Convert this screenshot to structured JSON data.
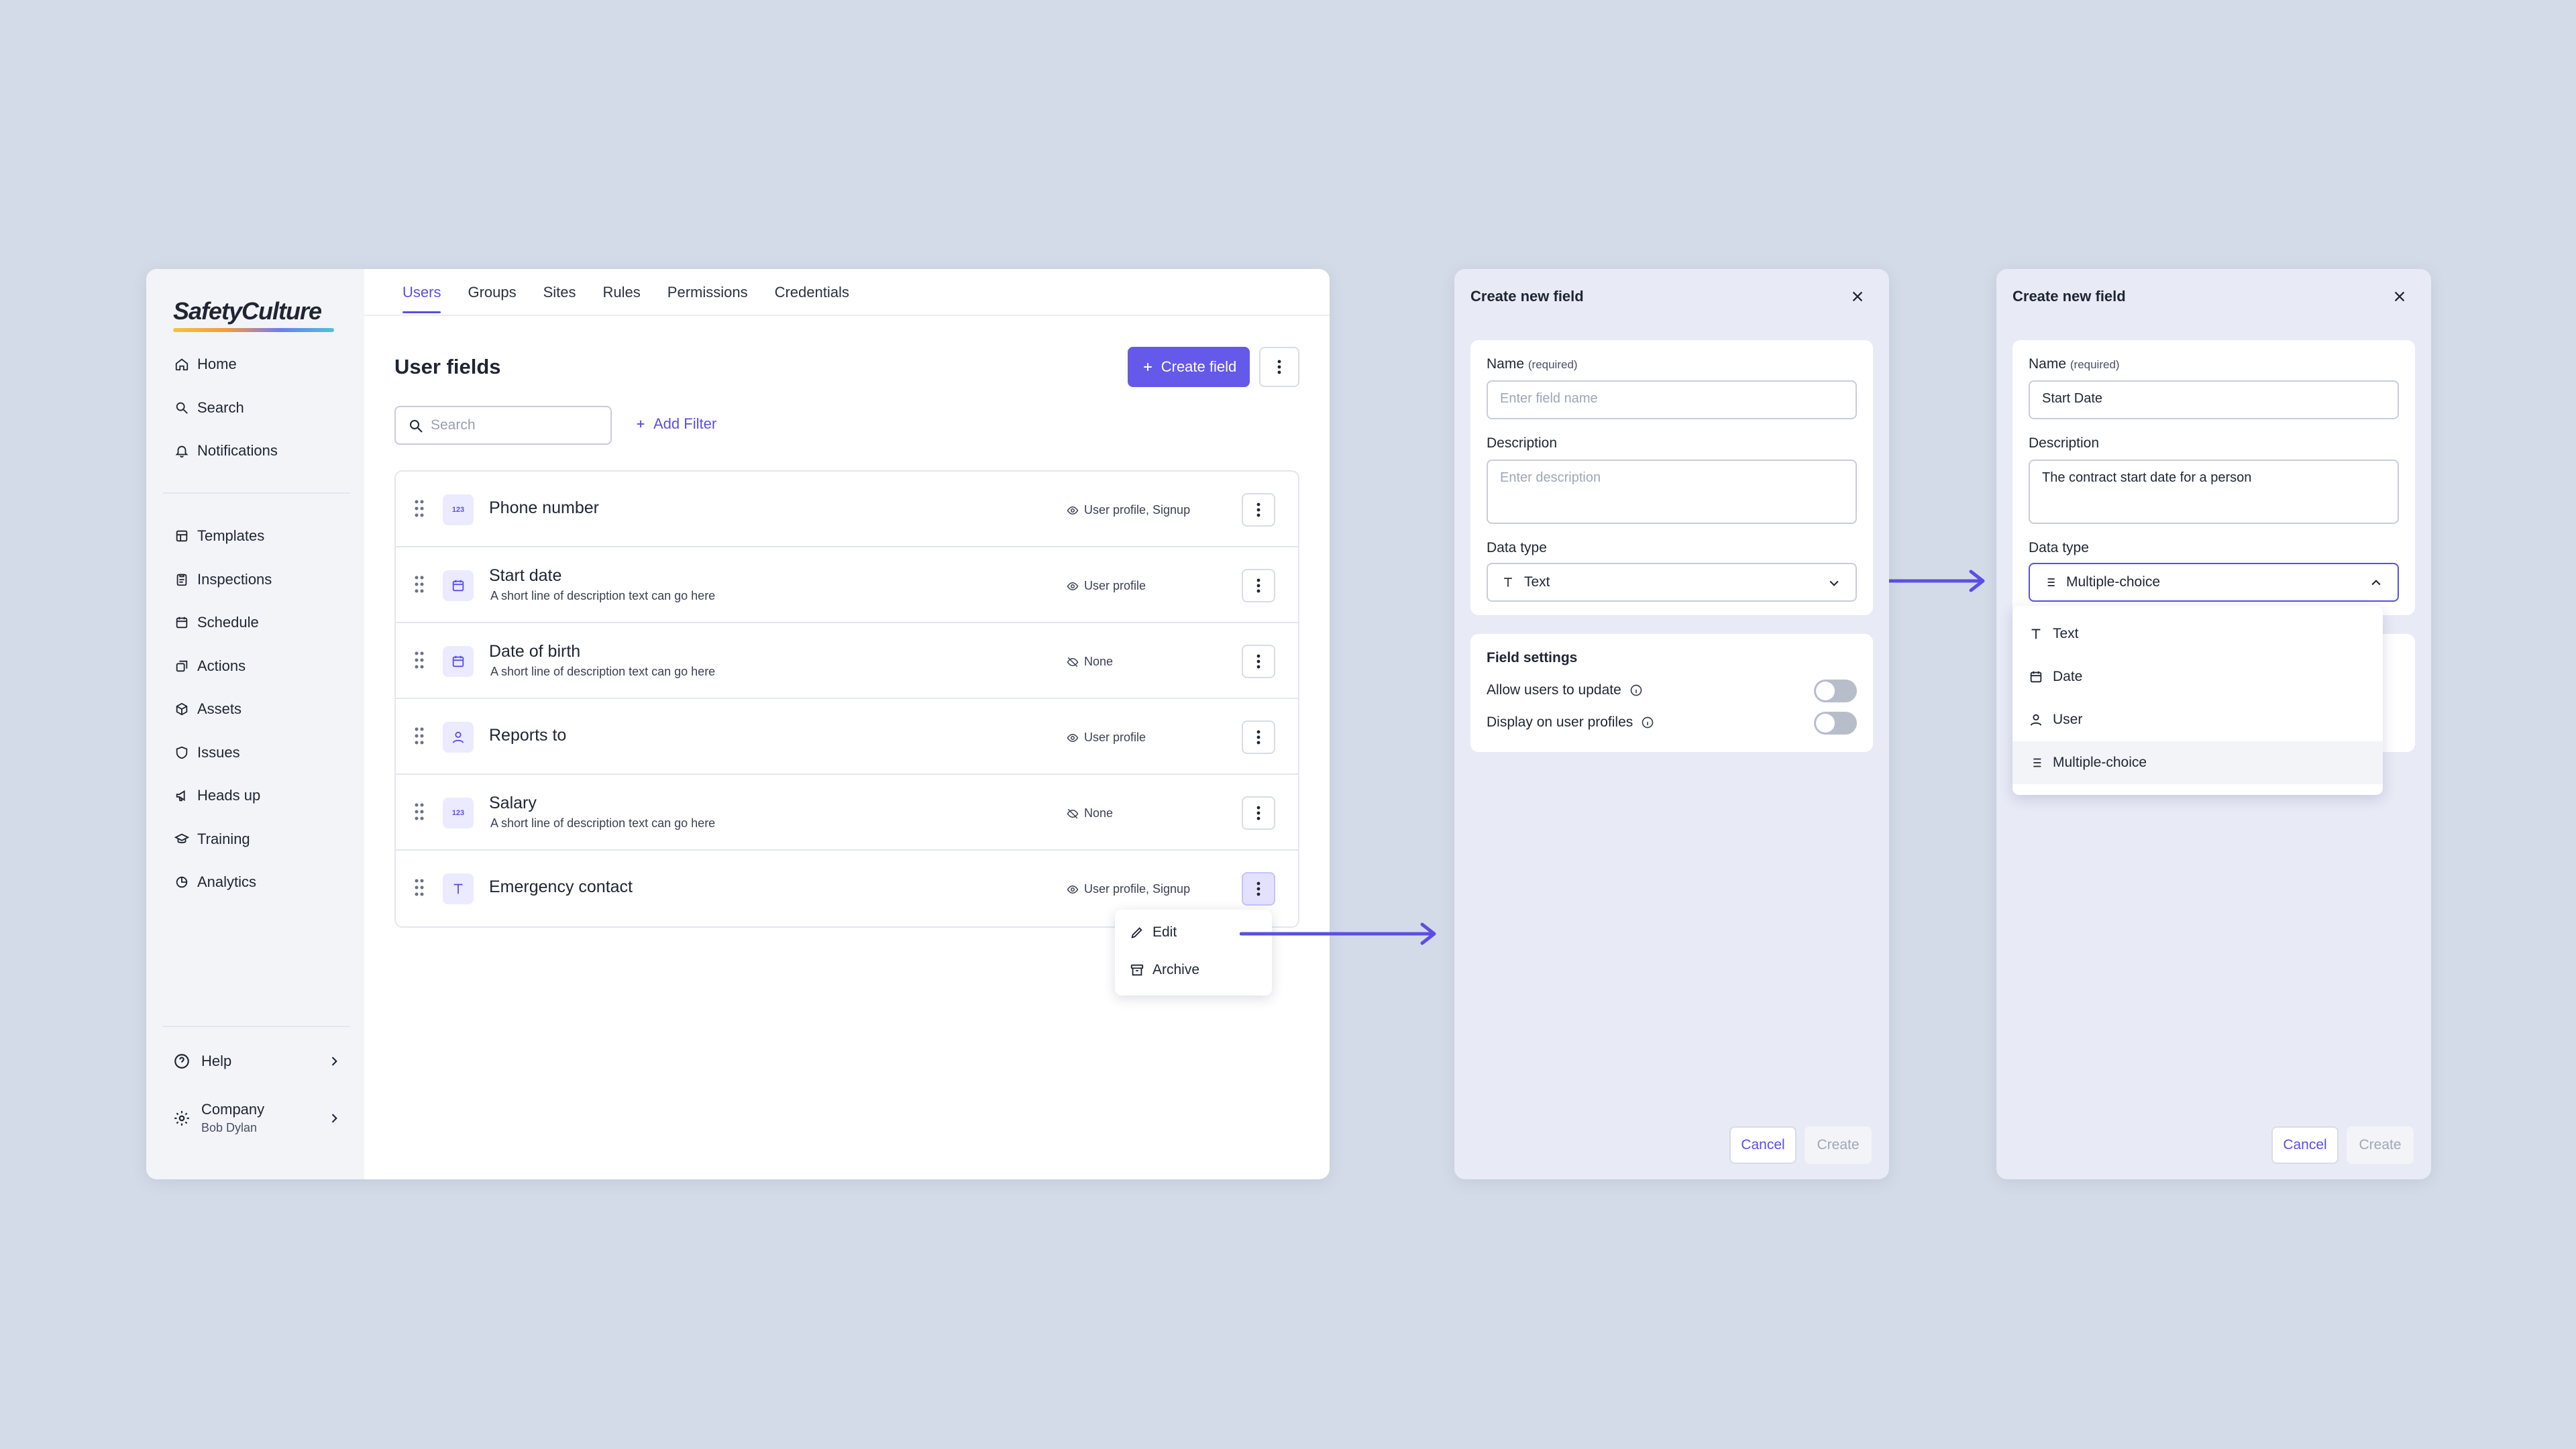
{
  "brand": "SafetyCulture",
  "nav": {
    "top": [
      {
        "label": "Home",
        "icon": "home-icon"
      },
      {
        "label": "Search",
        "icon": "search-icon"
      },
      {
        "label": "Notifications",
        "icon": "bell-icon"
      }
    ],
    "main": [
      {
        "label": "Templates",
        "icon": "templates-icon"
      },
      {
        "label": "Inspections",
        "icon": "clipboard-icon"
      },
      {
        "label": "Schedule",
        "icon": "calendar-icon"
      },
      {
        "label": "Actions",
        "icon": "actions-icon"
      },
      {
        "label": "Assets",
        "icon": "cube-icon"
      },
      {
        "label": "Issues",
        "icon": "shield-icon"
      },
      {
        "label": "Heads up",
        "icon": "megaphone-icon"
      },
      {
        "label": "Training",
        "icon": "graduation-cap-icon"
      },
      {
        "label": "Analytics",
        "icon": "pie-chart-icon"
      }
    ],
    "help": "Help",
    "company": "Company",
    "user": "Bob Dylan"
  },
  "tabs": [
    "Users",
    "Groups",
    "Sites",
    "Rules",
    "Permissions",
    "Credentials"
  ],
  "active_tab": "Users",
  "page": {
    "title": "User fields",
    "create_label": "Create field",
    "search_placeholder": "Search",
    "add_filter": "Add Filter"
  },
  "fields": [
    {
      "name": "Phone number",
      "description": "",
      "type": "number",
      "visibility": "User profile, Signup",
      "visible": true
    },
    {
      "name": "Start date",
      "description": "A short line of description text can go here",
      "type": "date",
      "visibility": "User profile",
      "visible": true
    },
    {
      "name": "Date of birth",
      "description": "A short line of description text can go here",
      "type": "date",
      "visibility": "None",
      "visible": false
    },
    {
      "name": "Reports to",
      "description": "",
      "type": "user",
      "visibility": "User profile",
      "visible": true
    },
    {
      "name": "Salary",
      "description": "A short line of description text can go here",
      "type": "number",
      "visibility": "None",
      "visible": false
    },
    {
      "name": "Emergency contact",
      "description": "",
      "type": "text",
      "visibility": "User profile, Signup",
      "visible": true
    }
  ],
  "number_badge": "123",
  "context_menu": {
    "edit": "Edit",
    "archive": "Archive"
  },
  "modal": {
    "title": "Create new field",
    "name_label": "Name",
    "required": "(required)",
    "name_placeholder": "Enter field name",
    "description_label": "Description",
    "description_placeholder": "Enter description",
    "data_type_label": "Data type",
    "field_settings": "Field settings",
    "allow_update": "Allow users to update",
    "display_profiles": "Display on user profiles",
    "cancel": "Cancel",
    "create": "Create"
  },
  "modal1": {
    "data_type": "Text"
  },
  "modal2": {
    "name_value": "Start Date",
    "description_value": "The contract start date for a person",
    "data_type": "Multiple-choice",
    "options": [
      "Text",
      "Date",
      "User",
      "Multiple-choice"
    ]
  },
  "colors": {
    "accent": "#6559ea",
    "background": "#d4dbe8",
    "modal_bg": "#e8eaf6"
  }
}
